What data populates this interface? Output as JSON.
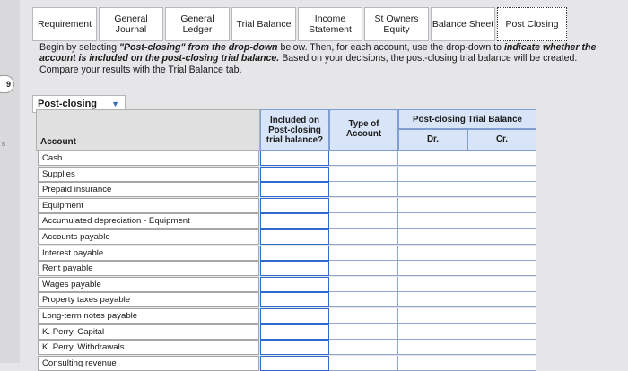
{
  "side": {
    "badge": "9",
    "mark": "s"
  },
  "tabs": [
    {
      "label": "Requirement"
    },
    {
      "label": "General Journal"
    },
    {
      "label": "General Ledger"
    },
    {
      "label": "Trial Balance"
    },
    {
      "label": "Income Statement"
    },
    {
      "label": "St Owners Equity"
    },
    {
      "label": "Balance Sheet"
    },
    {
      "label": "Post Closing",
      "active": true
    }
  ],
  "instructions": {
    "p1": "Begin by selecting ",
    "e1": "\"Post-closing\" from the drop-down",
    "p2": " below. Then, for each account, use the drop-down to ",
    "e2": "indicate whether the account is included on the post-closing trial balance.",
    "p3": " Based on your decisions, the post-closing trial balance will be created. Compare your results with the Trial Balance tab."
  },
  "dropdown": {
    "value": "Post-closing"
  },
  "table": {
    "headers": {
      "included": "Included on Post-closing trial balance?",
      "type": "Type of Account",
      "ptb": "Post-closing Trial Balance",
      "dr": "Dr.",
      "cr": "Cr.",
      "account": "Account"
    },
    "rows": [
      {
        "account": "Cash"
      },
      {
        "account": "Supplies"
      },
      {
        "account": "Prepaid insurance"
      },
      {
        "account": "Equipment"
      },
      {
        "account": "Accumulated depreciation - Equipment"
      },
      {
        "account": "Accounts payable"
      },
      {
        "account": "Interest payable"
      },
      {
        "account": "Rent payable"
      },
      {
        "account": "Wages payable"
      },
      {
        "account": "Property taxes payable"
      },
      {
        "account": "Long-term notes payable"
      },
      {
        "account": "K. Perry, Capital"
      },
      {
        "account": "K. Perry, Withdrawals"
      },
      {
        "account": "Consulting revenue"
      }
    ]
  }
}
